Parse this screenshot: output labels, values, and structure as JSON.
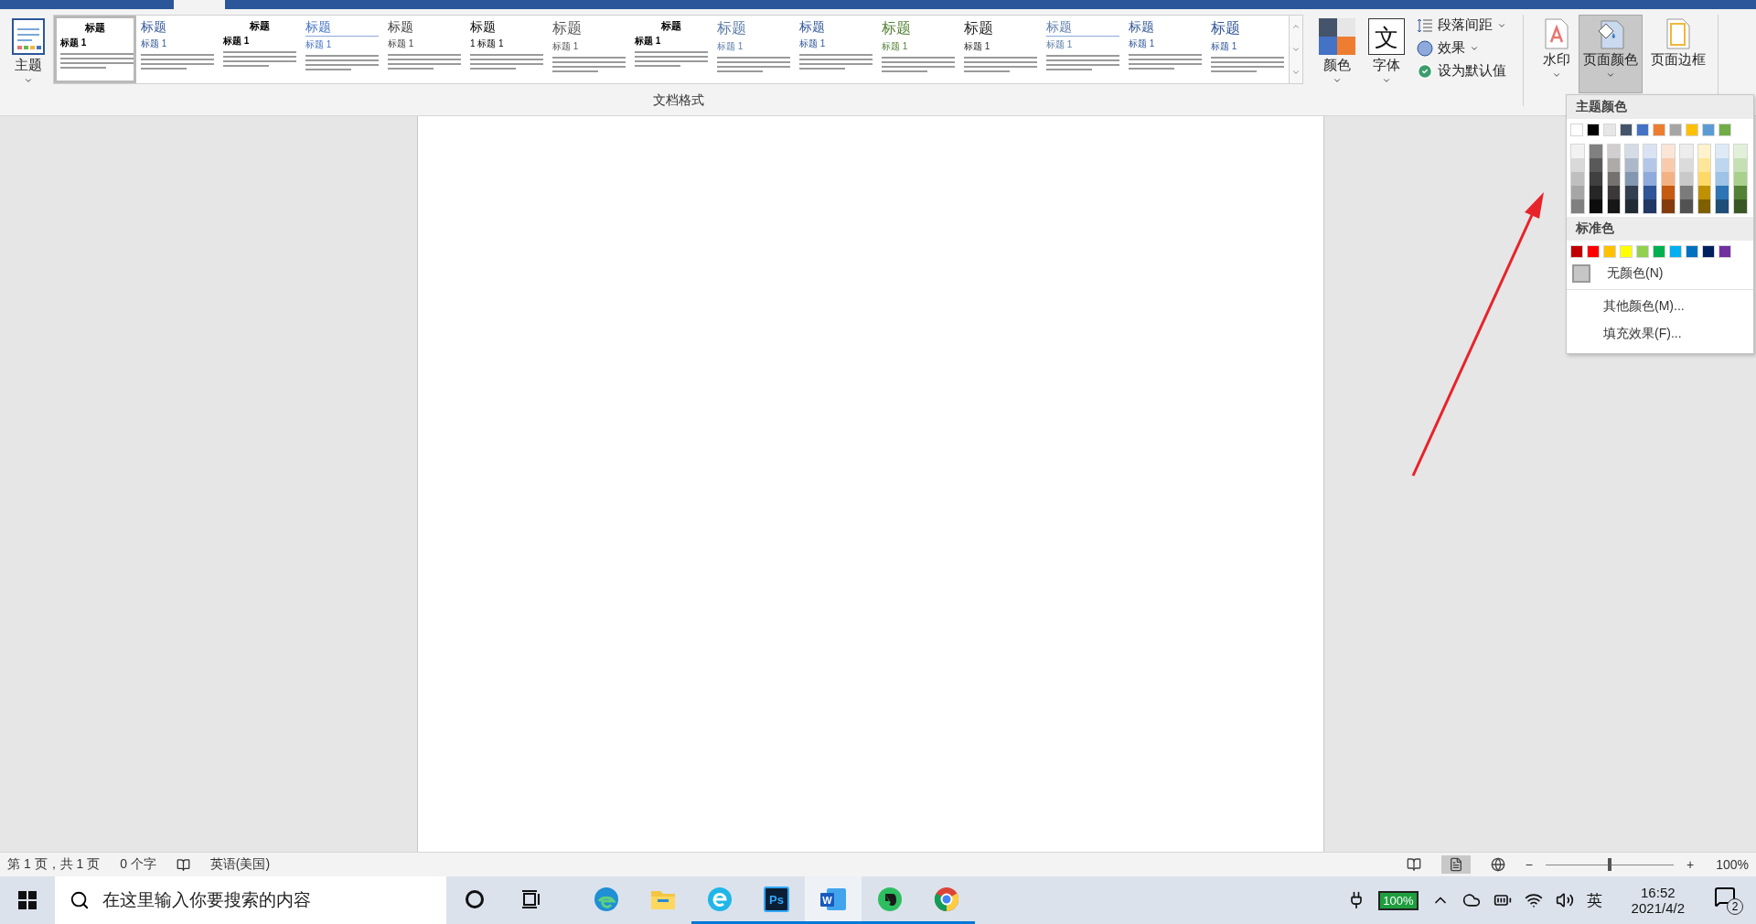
{
  "ribbon": {
    "theme_button": {
      "label": "主题"
    },
    "style_gallery": {
      "group_label": "文档格式",
      "items": [
        {
          "title": "标题",
          "heading": "标题 1",
          "kind": "center",
          "color": "#000000",
          "selected": true
        },
        {
          "title": "标题",
          "heading": "标题 1",
          "kind": "plain",
          "color": "#2f5597",
          "selected": false
        },
        {
          "title": "标题",
          "heading": "标题 1",
          "kind": "center",
          "color": "#000000",
          "selected": false
        },
        {
          "title": "标题",
          "heading": "标题 1",
          "kind": "rule",
          "color": "#4472c4",
          "selected": false
        },
        {
          "title": "标题",
          "heading": "标题 1",
          "kind": "plain",
          "color": "#404040",
          "selected": false
        },
        {
          "title": "标题",
          "heading": "1 标题 1",
          "kind": "plain",
          "color": "#000000",
          "selected": false
        },
        {
          "title": "标题",
          "heading": "标题 1",
          "kind": "large",
          "color": "#595959",
          "selected": false
        },
        {
          "title": "标题",
          "heading": "标题 1",
          "kind": "center",
          "color": "#000000",
          "selected": false
        },
        {
          "title": "标题",
          "heading": "标题 1",
          "kind": "large",
          "color": "#5b7da8",
          "selected": false
        },
        {
          "title": "标题",
          "heading": "标题 1",
          "kind": "plain",
          "color": "#2f5597",
          "selected": false
        },
        {
          "title": "标题",
          "heading": "标题 1",
          "kind": "large",
          "color": "#538135",
          "selected": false
        },
        {
          "title": "标题",
          "heading": "标题 1",
          "kind": "large",
          "color": "#262626",
          "selected": false
        },
        {
          "title": "标题",
          "heading": "标题 1",
          "kind": "rule",
          "color": "#5b7da8",
          "selected": false
        },
        {
          "title": "标题",
          "heading": "标题 1",
          "kind": "plain",
          "color": "#2f5597",
          "selected": false
        },
        {
          "title": "标题",
          "heading": "标题 1",
          "kind": "large",
          "color": "#2f5597",
          "selected": false
        }
      ]
    },
    "colors_button": {
      "label": "颜色"
    },
    "fonts_button": {
      "label": "字体",
      "glyph": "文"
    },
    "small_buttons": [
      {
        "label": "段落间距",
        "kind": "spacing"
      },
      {
        "label": "效果",
        "kind": "effects"
      },
      {
        "label": "设为默认值",
        "kind": "default"
      }
    ],
    "page_buttons": [
      {
        "label": "水印",
        "kind": "watermark",
        "selected": false
      },
      {
        "label": "页面颜色",
        "kind": "page_color",
        "selected": true
      },
      {
        "label": "页面边框",
        "kind": "page_border",
        "selected": false
      }
    ]
  },
  "page_color_menu": {
    "theme_heading": "主题颜色",
    "theme_colors": [
      {
        "color": "#ffffff",
        "shades": [
          {
            "color": "#f2f2f2"
          },
          {
            "color": "#d9d9d9"
          },
          {
            "color": "#bfbfbf"
          },
          {
            "color": "#a6a6a6"
          },
          {
            "color": "#808080"
          }
        ]
      },
      {
        "color": "#000000",
        "shades": [
          {
            "color": "#808080"
          },
          {
            "color": "#595959"
          },
          {
            "color": "#404040"
          },
          {
            "color": "#262626"
          },
          {
            "color": "#0d0d0d"
          }
        ]
      },
      {
        "color": "#e7e6e6",
        "shades": [
          {
            "color": "#d0cece"
          },
          {
            "color": "#aeaaaa"
          },
          {
            "color": "#757171"
          },
          {
            "color": "#3a3838"
          },
          {
            "color": "#171616"
          }
        ]
      },
      {
        "color": "#44546a",
        "shades": [
          {
            "color": "#d6dce5"
          },
          {
            "color": "#adb9ca"
          },
          {
            "color": "#8497b0"
          },
          {
            "color": "#333f50"
          },
          {
            "color": "#222a35"
          }
        ]
      },
      {
        "color": "#4472c4",
        "shades": [
          {
            "color": "#dae3f3"
          },
          {
            "color": "#b4c7e7"
          },
          {
            "color": "#8faadc"
          },
          {
            "color": "#2f5597"
          },
          {
            "color": "#203864"
          }
        ]
      },
      {
        "color": "#ed7d31",
        "shades": [
          {
            "color": "#fbe5d6"
          },
          {
            "color": "#f8cbad"
          },
          {
            "color": "#f4b183"
          },
          {
            "color": "#c55a11"
          },
          {
            "color": "#843c0c"
          }
        ]
      },
      {
        "color": "#a5a5a5",
        "shades": [
          {
            "color": "#ededed"
          },
          {
            "color": "#dbdbdb"
          },
          {
            "color": "#c9c9c9"
          },
          {
            "color": "#7b7b7b"
          },
          {
            "color": "#525252"
          }
        ]
      },
      {
        "color": "#ffc000",
        "shades": [
          {
            "color": "#fff2cc"
          },
          {
            "color": "#ffe699"
          },
          {
            "color": "#ffd966"
          },
          {
            "color": "#bf9000"
          },
          {
            "color": "#7f6000"
          }
        ]
      },
      {
        "color": "#5b9bd5",
        "shades": [
          {
            "color": "#deebf7"
          },
          {
            "color": "#bdd7ee"
          },
          {
            "color": "#9dc3e6"
          },
          {
            "color": "#2e75b6"
          },
          {
            "color": "#1f4e79"
          }
        ]
      },
      {
        "color": "#70ad47",
        "shades": [
          {
            "color": "#e2f0d9"
          },
          {
            "color": "#c5e0b4"
          },
          {
            "color": "#a9d18e"
          },
          {
            "color": "#548235"
          },
          {
            "color": "#385723"
          }
        ]
      }
    ],
    "standard_heading": "标准色",
    "standard_colors": [
      {
        "color": "#c00000"
      },
      {
        "color": "#ff0000"
      },
      {
        "color": "#ffc000"
      },
      {
        "color": "#ffff00"
      },
      {
        "color": "#92d050"
      },
      {
        "color": "#00b050"
      },
      {
        "color": "#00b0f0"
      },
      {
        "color": "#0070c0"
      },
      {
        "color": "#002060"
      },
      {
        "color": "#7030a0"
      }
    ],
    "no_color": "无颜色(N)",
    "items": [
      "其他颜色(M)...",
      "填充效果(F)..."
    ]
  },
  "status_bar": {
    "page": "第 1 页，共 1 页",
    "words": "0 个字",
    "language": "英语(美国)",
    "views": [
      {
        "kind": "read",
        "selected": false
      },
      {
        "kind": "print",
        "selected": true
      },
      {
        "kind": "web",
        "selected": false
      }
    ],
    "zoom_out": "−",
    "zoom": {
      "level": 0.5
    },
    "zoom_in": "+",
    "zoom_reading": "100%"
  },
  "taskbar": {
    "search": {
      "placeholder": "在这里输入你要搜索的内容"
    },
    "apps": [
      {
        "kind": "edge",
        "running": false,
        "selected": false
      },
      {
        "kind": "explorer",
        "running": false,
        "selected": false
      },
      {
        "kind": "ie",
        "running": true,
        "selected": false
      },
      {
        "kind": "ps",
        "glyph": "Ps",
        "running": true,
        "selected": false
      },
      {
        "kind": "word",
        "glyph": "W",
        "running": true,
        "selected": true
      },
      {
        "kind": "evernote",
        "running": true,
        "selected": false
      },
      {
        "kind": "chrome",
        "running": true,
        "selected": false
      }
    ],
    "battery": "100%",
    "ime": "英",
    "time": "16:52",
    "date": "2021/4/2",
    "notifications": "2"
  }
}
